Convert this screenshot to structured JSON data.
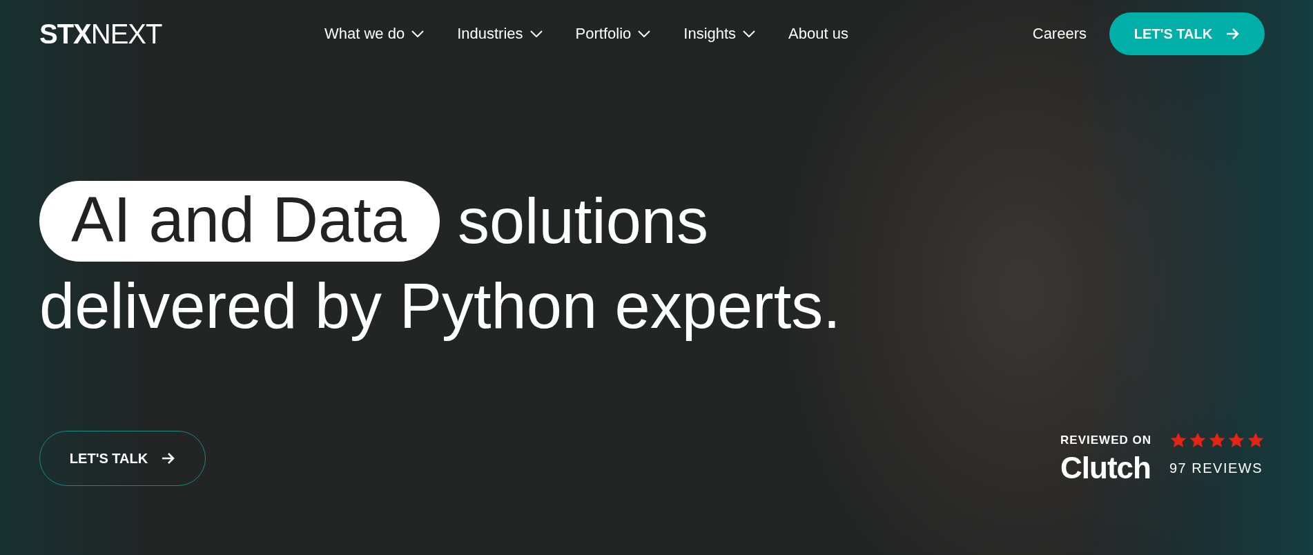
{
  "logo": {
    "bold": "STX",
    "light": "NEXT"
  },
  "nav": [
    {
      "label": "What we do",
      "dropdown": true
    },
    {
      "label": "Industries",
      "dropdown": true
    },
    {
      "label": "Portfolio",
      "dropdown": true
    },
    {
      "label": "Insights",
      "dropdown": true
    },
    {
      "label": "About us",
      "dropdown": false
    }
  ],
  "header_link": "Careers",
  "header_button": "LET'S TALK",
  "headline": {
    "highlight": "AI and Data",
    "rest": "solutions",
    "line2": "delivered by Python experts."
  },
  "cta_button": "LET'S TALK",
  "review": {
    "label": "REVIEWED ON",
    "brand": "Clutch",
    "stars": 5,
    "count": "97 REVIEWS"
  }
}
